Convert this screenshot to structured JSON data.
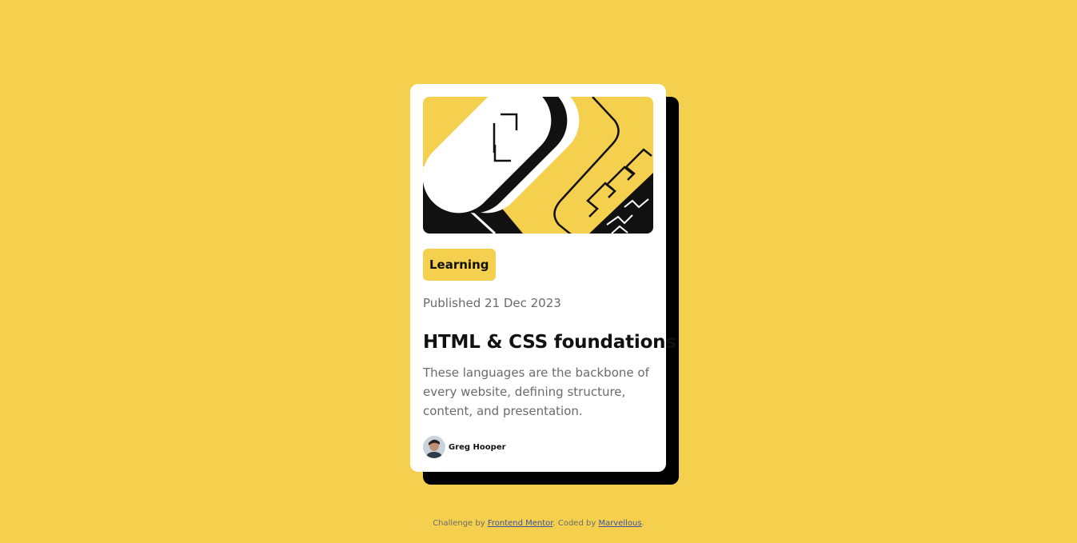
{
  "card": {
    "tag": "Learning",
    "published": "Published 21 Dec 2023",
    "title": "HTML & CSS foundations",
    "description": "These languages are the backbone of every website, defining structure, content, and presentation.",
    "author": "Greg Hooper"
  },
  "attribution": {
    "prefix": "Challenge by ",
    "link1": "Frontend Mentor",
    "middle": ". Coded by ",
    "link2": "Marvellous",
    "suffix": "."
  },
  "colors": {
    "background": "#F4D04E",
    "card": "#FFFFFF",
    "shadow": "#000000",
    "text_primary": "#111111",
    "text_secondary": "#6B6B6B",
    "link": "#3E52A3"
  },
  "icons": {
    "illustration": "abstract-geometric-illustration",
    "avatar": "author-avatar-photo"
  }
}
